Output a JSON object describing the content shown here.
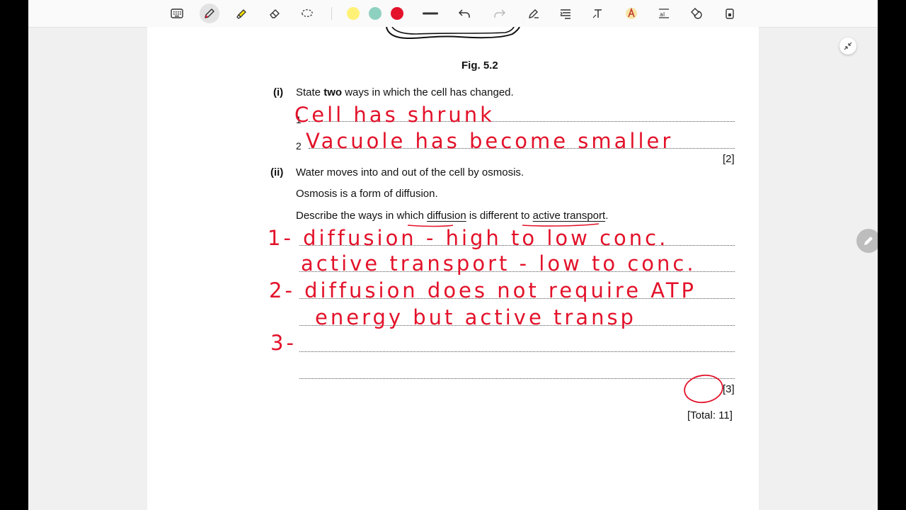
{
  "toolbar": {
    "tools": [
      "keyboard-icon",
      "pen-icon",
      "highlighter-icon",
      "eraser-icon",
      "lasso-icon"
    ],
    "colors": [
      "#fff176",
      "#8fd1c0",
      "#e3122a"
    ],
    "actions": [
      "line-icon",
      "undo-icon",
      "redo-icon",
      "pen-settings-icon",
      "text-align-icon",
      "text-tool-icon",
      "color-text-icon",
      "text-size-icon",
      "shapes-icon",
      "lock-icon"
    ]
  },
  "question": {
    "figure_label": "Fig. 5.2",
    "part_i": {
      "number": "(i)",
      "prompt_before": "State ",
      "prompt_bold": "two",
      "prompt_after": " ways in which the cell has changed.",
      "line1_num": "1",
      "line2_num": "2",
      "marks": "[2]"
    },
    "part_ii": {
      "number": "(ii)",
      "line_a": "Water moves into and out of the cell by osmosis.",
      "line_b": "Osmosis is a form of diffusion.",
      "describe_1": "Describe the ways in which ",
      "describe_u1": "diffusion",
      "describe_2": " is different to ",
      "describe_u2": "active transport",
      "describe_3": ".",
      "marks": "[3]"
    },
    "total": "[Total: 11]"
  },
  "handwriting": {
    "answer_i_1": "Cell has shrunk",
    "answer_i_2": "Vacuole has become smaller",
    "answer_ii_1": "1- diffusion - high to low conc.",
    "answer_ii_2": "active transport - low to conc.",
    "answer_ii_3": "2- diffusion does not require ATP",
    "answer_ii_4": "energy but active transp",
    "answer_ii_5": "3-",
    "ink_color": "#e3122a"
  },
  "side_buttons": [
    "collapse-icon",
    "edit-pencil-icon"
  ]
}
